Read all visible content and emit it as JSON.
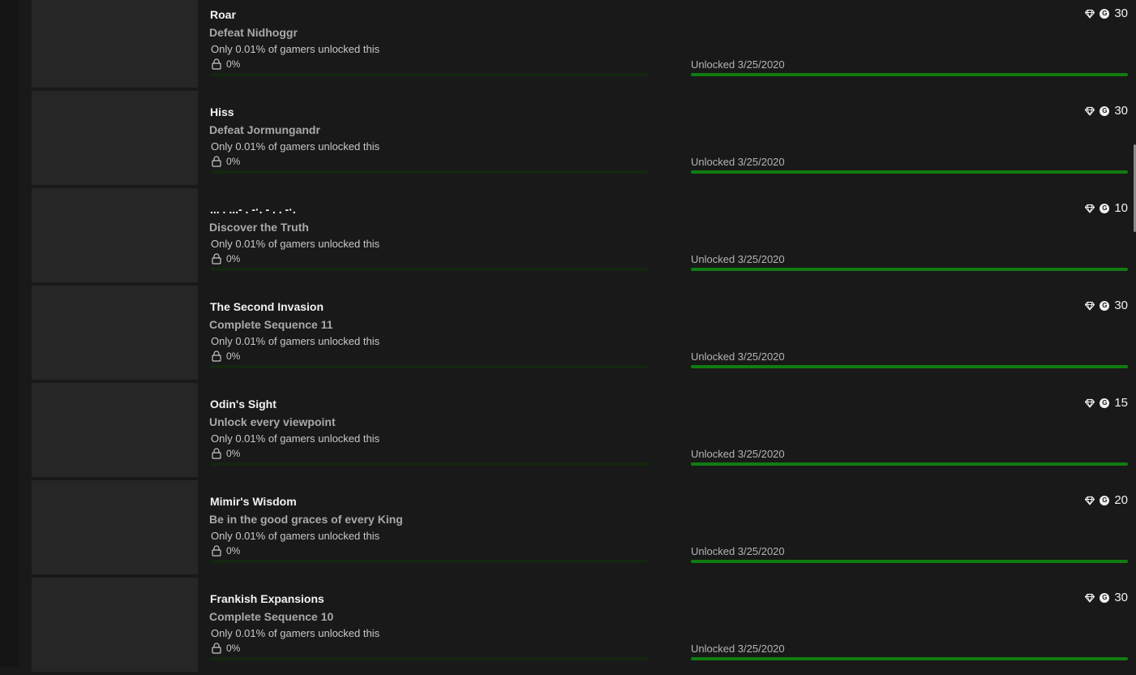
{
  "achievements": [
    {
      "title": "Roar",
      "description": "Defeat Nidhoggr",
      "rarity": "Only 0.01% of gamers unlocked this",
      "global_pct": "0%",
      "global_fraction": 0.0,
      "unlocked_text": "Unlocked 3/25/2020",
      "unlocked_fraction": 1.0,
      "gamerscore": "30"
    },
    {
      "title": "Hiss",
      "description": "Defeat Jormungandr",
      "rarity": "Only 0.01% of gamers unlocked this",
      "global_pct": "0%",
      "global_fraction": 0.0,
      "unlocked_text": "Unlocked 3/25/2020",
      "unlocked_fraction": 1.0,
      "gamerscore": "30"
    },
    {
      "title": "... . ...- . -·. - . . -·.",
      "description": "Discover the Truth",
      "rarity": "Only 0.01% of gamers unlocked this",
      "global_pct": "0%",
      "global_fraction": 0.0,
      "unlocked_text": "Unlocked 3/25/2020",
      "unlocked_fraction": 1.0,
      "gamerscore": "10"
    },
    {
      "title": "The Second Invasion",
      "description": "Complete Sequence 11",
      "rarity": "Only 0.01% of gamers unlocked this",
      "global_pct": "0%",
      "global_fraction": 0.0,
      "unlocked_text": "Unlocked 3/25/2020",
      "unlocked_fraction": 1.0,
      "gamerscore": "30"
    },
    {
      "title": "Odin's Sight",
      "description": "Unlock every viewpoint",
      "rarity": "Only 0.01% of gamers unlocked this",
      "global_pct": "0%",
      "global_fraction": 0.0,
      "unlocked_text": "Unlocked 3/25/2020",
      "unlocked_fraction": 1.0,
      "gamerscore": "15"
    },
    {
      "title": "Mimir's Wisdom",
      "description": "Be in the good graces of every King",
      "rarity": "Only 0.01% of gamers unlocked this",
      "global_pct": "0%",
      "global_fraction": 0.0,
      "unlocked_text": "Unlocked 3/25/2020",
      "unlocked_fraction": 1.0,
      "gamerscore": "20"
    },
    {
      "title": "Frankish Expansions",
      "description": "Complete Sequence 10",
      "rarity": "Only 0.01% of gamers unlocked this",
      "global_pct": "0%",
      "global_fraction": 0.0,
      "unlocked_text": "Unlocked 3/25/2020",
      "unlocked_fraction": 1.0,
      "gamerscore": "30"
    }
  ],
  "icons": {
    "rarity": "diamond-icon",
    "gamerscore": "gamerscore-g-icon",
    "lock": "lock-icon",
    "gamerscore_letter": "G"
  },
  "colors": {
    "background": "#191919",
    "thumbnail": "#262626",
    "progress_green": "#107c10",
    "progress_track": "#14260f"
  }
}
